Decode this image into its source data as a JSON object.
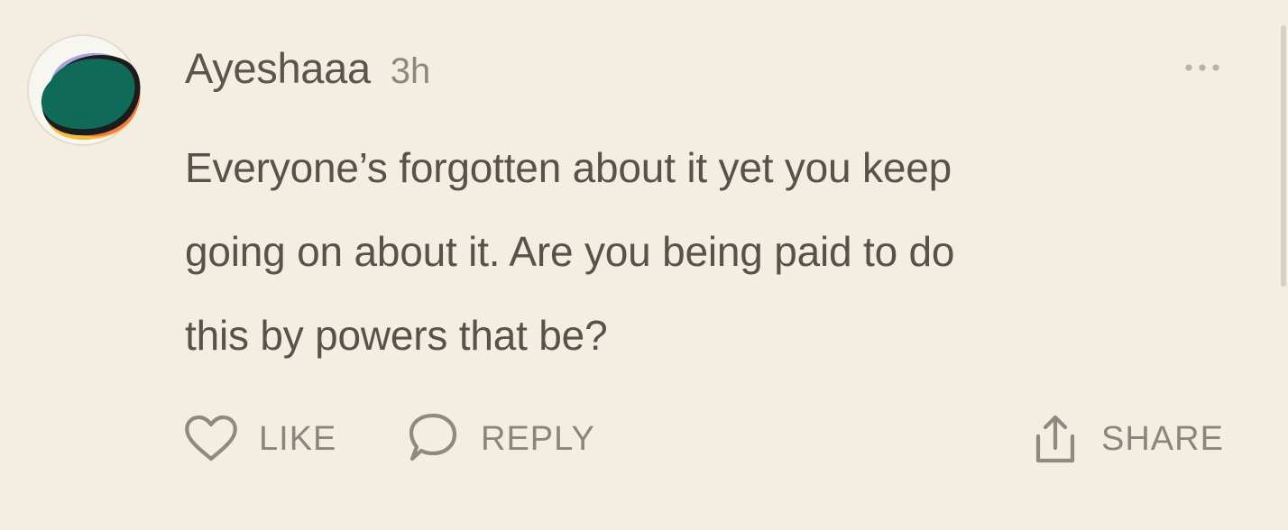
{
  "comment": {
    "author": "Ayeshaaa",
    "timestamp": "3h",
    "lines": [
      "Everyone’s forgotten about it yet you keep",
      "going on about it. Are you being paid to do",
      "this by powers that be?"
    ]
  },
  "actions": {
    "like_label": "LIKE",
    "reply_label": "REPLY",
    "share_label": "SHARE"
  },
  "icons": {
    "avatar": "avatar-multicolor-blob",
    "more": "more-horizontal-icon",
    "like": "heart-outline-icon",
    "reply": "speech-bubble-icon",
    "share": "share-upload-icon"
  },
  "colors": {
    "background": "#f4ede2",
    "text": "#57524a",
    "muted_text": "#8b857b",
    "avatar_green": "#0f6b57",
    "avatar_yellow": "#f3be3d",
    "avatar_orange": "#ef7a45",
    "avatar_purple": "#a9a5d8"
  }
}
